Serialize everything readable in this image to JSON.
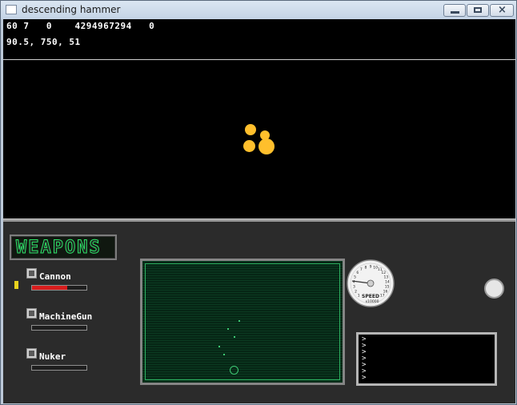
{
  "window": {
    "title": "descending hammer",
    "close_glyph": "×"
  },
  "hud": {
    "line1": "60 7   0    4294967294   0",
    "line2": "90.5, 750, 51"
  },
  "weapons_panel": {
    "title": "WEAPONS",
    "items": [
      {
        "name": "Cannon",
        "ammo_fraction": 0.65,
        "selected": true
      },
      {
        "name": "MachineGun",
        "ammo_fraction": 0.0,
        "selected": false
      },
      {
        "name": "Nuker",
        "ammo_fraction": 0.0,
        "selected": false
      }
    ]
  },
  "speedometer": {
    "label": "SPEED",
    "unit": "x10000",
    "ticks": [
      "1",
      "2",
      "3",
      "4",
      "5",
      "6",
      "7",
      "8",
      "9",
      "10",
      "11",
      "12",
      "13",
      "14",
      "15",
      "16",
      "17"
    ]
  },
  "messages": {
    "lines": ">\n>\n>\n>\n>\n>\n>"
  },
  "colors": {
    "explosion": "#ffbf2c",
    "radar": "#3ec974",
    "ammo_bar": "#d81d1d",
    "weapons_title": "#2ee86a"
  }
}
